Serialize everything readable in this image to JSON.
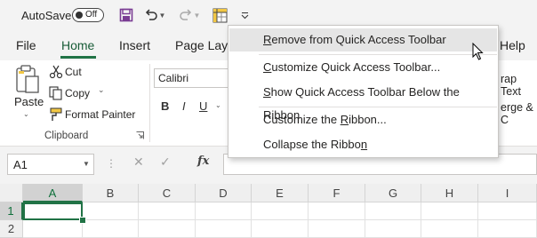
{
  "autosave": {
    "label": "AutoSave",
    "state": "Off"
  },
  "tabs": [
    "File",
    "Home",
    "Insert",
    "Page Layo",
    "Help"
  ],
  "ribbon": {
    "paste": "Paste",
    "cut": "Cut",
    "copy": "Copy",
    "format_painter": "Format Painter",
    "clipboard_group": "Clipboard",
    "font_name": "Calibri",
    "bold": "B",
    "italic": "I",
    "underline": "U",
    "wrap_text_partial": "rap Text",
    "merge_partial": "erge & C"
  },
  "formula_bar": {
    "name_box": "A1",
    "fx": "fx"
  },
  "grid": {
    "columns": [
      "A",
      "B",
      "C",
      "D",
      "E",
      "F",
      "G",
      "H",
      "I"
    ],
    "rows": [
      "1",
      "2"
    ]
  },
  "context_menu": {
    "items": [
      {
        "pre": "",
        "acc": "R",
        "post": "emove from Quick Access Toolbar"
      },
      {
        "pre": "",
        "acc": "C",
        "post": "ustomize Quick Access Toolbar..."
      },
      {
        "pre": "",
        "acc": "S",
        "post": "how Quick Access Toolbar Below the Ribbon"
      },
      {
        "pre": "Customize the ",
        "acc": "R",
        "post": "ibbon..."
      },
      {
        "pre": "Collapse the Ribbo",
        "acc": "n",
        "post": ""
      }
    ]
  },
  "colors": {
    "excel_green": "#217346",
    "save_purple": "#7a3c93"
  },
  "icons": [
    "save-icon",
    "undo-icon",
    "redo-icon",
    "pivot-table-icon",
    "customize-qat-icon",
    "paste-icon",
    "cut-icon",
    "copy-icon",
    "format-painter-icon"
  ]
}
